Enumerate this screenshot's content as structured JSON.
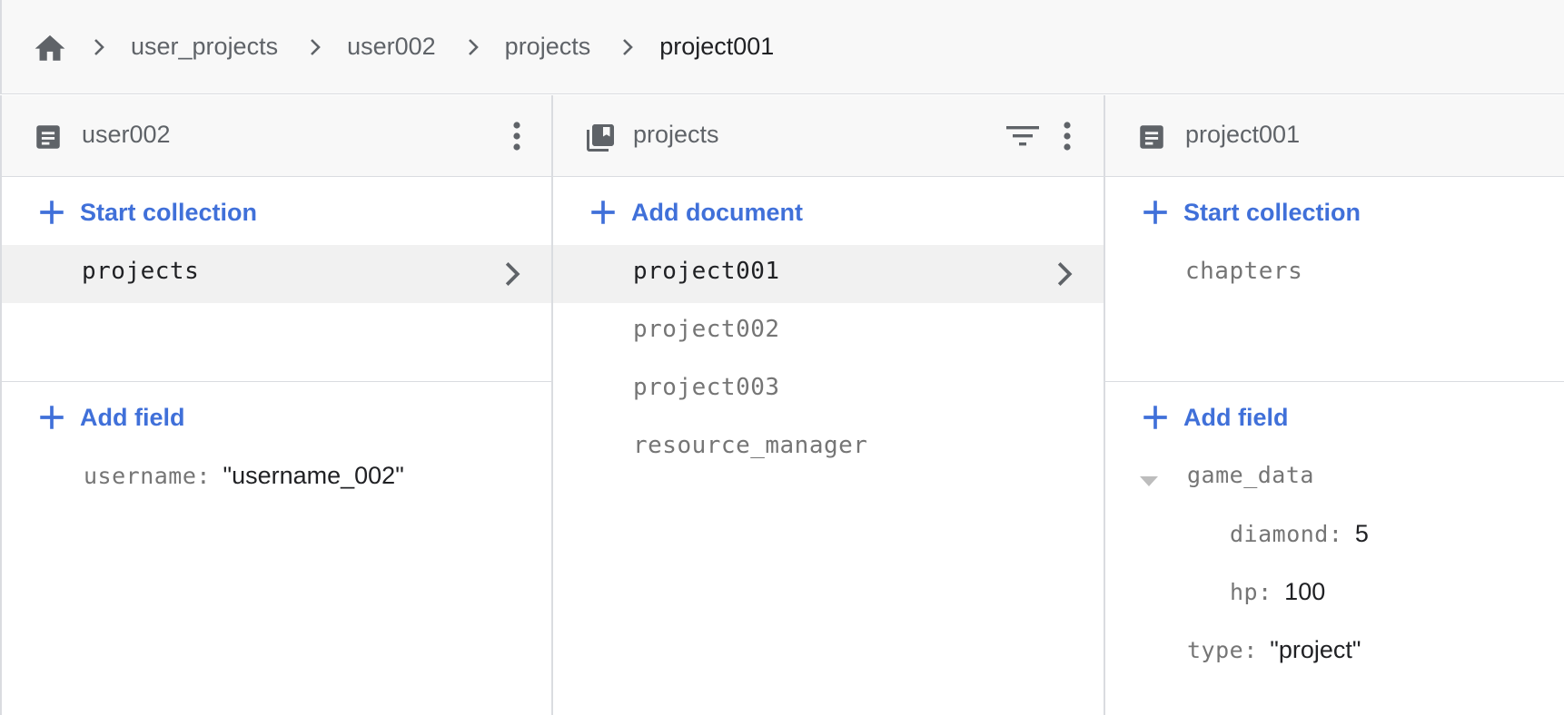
{
  "breadcrumb": {
    "home_icon": "home-icon",
    "items": [
      "user_projects",
      "user002",
      "projects",
      "project001"
    ]
  },
  "panels": {
    "user_doc": {
      "icon": "document-icon",
      "title": "user002",
      "start_collection": "Start collection",
      "collections": [
        "projects"
      ],
      "add_field": "Add field",
      "fields": [
        {
          "key": "username",
          "value": "\"username_002\""
        }
      ]
    },
    "projects_collection": {
      "icon": "collection-icon",
      "title": "projects",
      "add_document": "Add document",
      "documents": [
        "project001",
        "project002",
        "project003",
        "resource_manager"
      ]
    },
    "project_doc": {
      "icon": "document-icon",
      "title": "project001",
      "start_collection": "Start collection",
      "collections": [
        "chapters"
      ],
      "add_field": "Add field",
      "fields": {
        "map_key": "game_data",
        "map_entries": [
          {
            "key": "diamond",
            "value": "5"
          },
          {
            "key": "hp",
            "value": "100"
          }
        ],
        "type_key": "type",
        "type_value": "\"project\""
      }
    }
  },
  "colors": {
    "accent": "#4070d9",
    "header_bg": "#f8f8f8",
    "selected_bg": "#f1f1f1",
    "border": "#dadce0"
  }
}
